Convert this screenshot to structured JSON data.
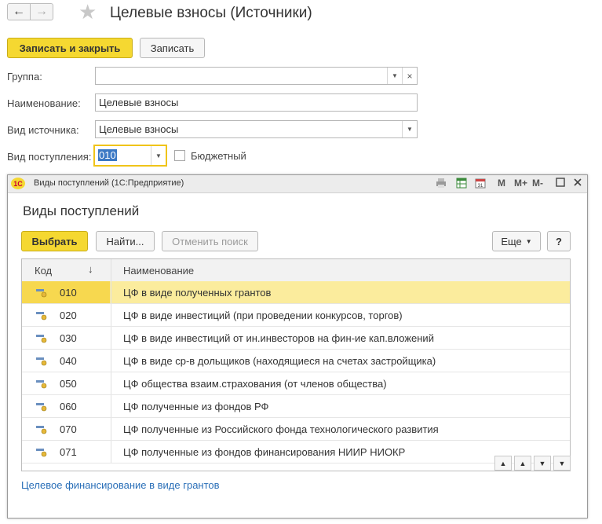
{
  "header": {
    "back_icon": "←",
    "forward_icon": "→",
    "star_icon": "★",
    "title": "Целевые взносы (Источники)"
  },
  "toolbar": {
    "save_close_label": "Записать и закрыть",
    "save_label": "Записать"
  },
  "form": {
    "group_label": "Группа:",
    "group_value": "",
    "name_label": "Наименование:",
    "name_value": "Целевые взносы",
    "source_type_label": "Вид источника:",
    "source_type_value": "Целевые взносы",
    "receipt_type_label": "Вид поступления:",
    "receipt_type_value": "010",
    "budget_label": "Бюджетный"
  },
  "dialog": {
    "window_title": "Виды поступлений  (1С:Предприятие)",
    "logo_text": "1С",
    "toolbar_icons": [
      "M",
      "M+",
      "M-"
    ],
    "heading": "Виды поступлений",
    "select_label": "Выбрать",
    "find_label": "Найти...",
    "cancel_search_label": "Отменить поиск",
    "more_label": "Еще",
    "help_label": "?",
    "columns": {
      "code": "Код",
      "name": "Наименование",
      "sort_icon": "↓"
    },
    "rows": [
      {
        "code": "010",
        "name": "ЦФ в виде полученных грантов"
      },
      {
        "code": "020",
        "name": "ЦФ в виде инвестиций (при проведении конкурсов, торгов)"
      },
      {
        "code": "030",
        "name": "ЦФ в виде инвестиций от ин.инвесторов на фин-ие кап.вложений"
      },
      {
        "code": "040",
        "name": "ЦФ в виде ср-в дольщиков (находящиеся на счетах застройщика)"
      },
      {
        "code": "050",
        "name": "ЦФ общества взаим.страхования (от членов общества)"
      },
      {
        "code": "060",
        "name": "ЦФ полученные из фондов РФ"
      },
      {
        "code": "070",
        "name": "ЦФ полученные из Российского фонда технологического развития"
      },
      {
        "code": "071",
        "name": "ЦФ полученные из фондов финансирования НИИР НИОКР"
      }
    ],
    "selected_row": 0,
    "footer_text": "Целевое финансирование в виде грантов"
  }
}
